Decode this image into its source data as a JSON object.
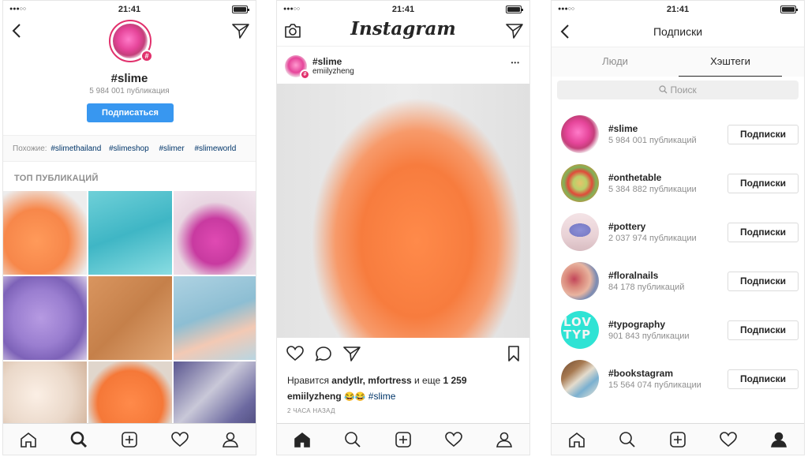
{
  "status": {
    "signal": "●●●○○",
    "time": "21:41"
  },
  "hashtag_page": {
    "title": "#slime",
    "count": "5 984 001 публикация",
    "follow_label": "Подписаться",
    "related_label": "Похожие:",
    "related": [
      "#slimethailand",
      "#slimeshop",
      "#slimer",
      "#slimeworld"
    ],
    "top_posts_label": "ТОП ПУБЛИКАЦИЙ",
    "badge_symbol": "#"
  },
  "feed": {
    "logo": "Instagram",
    "post": {
      "hashtag": "#slime",
      "username": "emiilyzheng",
      "likes_prefix": "Нравится",
      "likers": "andytlr, mfortress",
      "likes_and": "и еще",
      "likes_count": "1 259",
      "caption_user": "emiilyzheng",
      "caption_emoji": "😂😂",
      "caption_tag": "#slime",
      "time": "2 ЧАСА НАЗАД",
      "more": "•••"
    }
  },
  "following": {
    "title": "Подписки",
    "tabs": [
      "Люди",
      "Хэштеги"
    ],
    "active_tab": "Хэштеги",
    "search_placeholder": "Поиск",
    "items": [
      {
        "tag": "#slime",
        "count": "5 984 001 публикаций",
        "button": "Подписки"
      },
      {
        "tag": "#onthetable",
        "count": "5 384 882 публикации",
        "button": "Подписки"
      },
      {
        "tag": "#pottery",
        "count": "2 037 974 публикации",
        "button": "Подписки"
      },
      {
        "tag": "#floralnails",
        "count": "84 178 публикаций",
        "button": "Подписки"
      },
      {
        "tag": "#typography",
        "count": "901 843 публикации",
        "button": "Подписки"
      },
      {
        "tag": "#bookstagram",
        "count": "15 564 074 публикации",
        "button": "Подписки"
      }
    ]
  },
  "typography_thumb_text": "LOVTYP",
  "colors": {
    "link": "#003569",
    "accent": "#3897f0",
    "badge": "#e1306c"
  },
  "icons": [
    "back-icon",
    "direct-icon",
    "camera-icon",
    "heart-icon",
    "comment-icon",
    "bookmark-icon",
    "home-icon",
    "search-icon",
    "add-icon",
    "profile-icon"
  ]
}
